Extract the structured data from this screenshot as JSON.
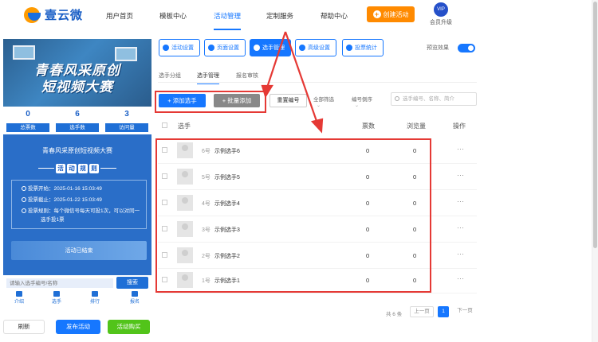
{
  "brand": {
    "name": "壹云微"
  },
  "nav": {
    "items": [
      "用户首页",
      "模板中心",
      "活动管理",
      "定制服务",
      "帮助中心"
    ],
    "create_label": "创建活动",
    "vip_badge": "VIP",
    "vip_label": "会员升级"
  },
  "preview": {
    "banner_line1": "青春风采原创",
    "banner_line2": "短视频大赛",
    "stats": [
      {
        "value": "0",
        "label": "总票数"
      },
      {
        "value": "6",
        "label": "选手数"
      },
      {
        "value": "3",
        "label": "访问量"
      }
    ],
    "activity_title": "青春风采原创短视频大赛",
    "rules_chars": [
      "活",
      "动",
      "规",
      "则"
    ],
    "rules": [
      "投票开始：2025-01-16 15:03:49",
      "投票截止：2025-01-22 15:03:49",
      "投票规则：每个微信号每天可投1次，可以对同一",
      "选手投1票"
    ],
    "status": "活动已结束",
    "search_placeholder": "请输入选手编号/名称",
    "search_button": "搜索",
    "tabs": [
      "介绍",
      "选手",
      "排行",
      "报名"
    ]
  },
  "footer": {
    "refresh": "刷新",
    "publish": "发布活动",
    "buy": "活动购买"
  },
  "toolbar": {
    "buttons": [
      "活动设置",
      "页面设置",
      "选手管理",
      "高级设置",
      "投票统计"
    ],
    "preview_label": "预览效果"
  },
  "subtabs": [
    "选手分组",
    "选手管理",
    "报名审核"
  ],
  "actions": {
    "add": "+ 添加选手",
    "batch": "+ 批量添加",
    "reset": "重置编号",
    "filter_all": "全部筛选",
    "sort": "编号倒序",
    "search_placeholder": "选手编号、名称、简介"
  },
  "table": {
    "headers": [
      "选手",
      "票数",
      "浏览量",
      "操作"
    ],
    "rows": [
      {
        "no": "6号",
        "name": "示例选手6",
        "votes": "0",
        "views": "0",
        "more": "···"
      },
      {
        "no": "5号",
        "name": "示例选手5",
        "votes": "0",
        "views": "0",
        "more": "···"
      },
      {
        "no": "4号",
        "name": "示例选手4",
        "votes": "0",
        "views": "0",
        "more": "···"
      },
      {
        "no": "3号",
        "name": "示例选手3",
        "votes": "0",
        "views": "0",
        "more": "···"
      },
      {
        "no": "2号",
        "name": "示例选手2",
        "votes": "0",
        "views": "0",
        "more": "···"
      },
      {
        "no": "1号",
        "name": "示例选手1",
        "votes": "0",
        "views": "0",
        "more": "···"
      }
    ]
  },
  "pager": {
    "total": "共 6 条",
    "prev": "上一页",
    "current": "1",
    "next": "下一页"
  },
  "colors": {
    "accent": "#1677ff",
    "highlight": "#e53935",
    "orange": "#ff8a00",
    "green": "#52c41a"
  }
}
